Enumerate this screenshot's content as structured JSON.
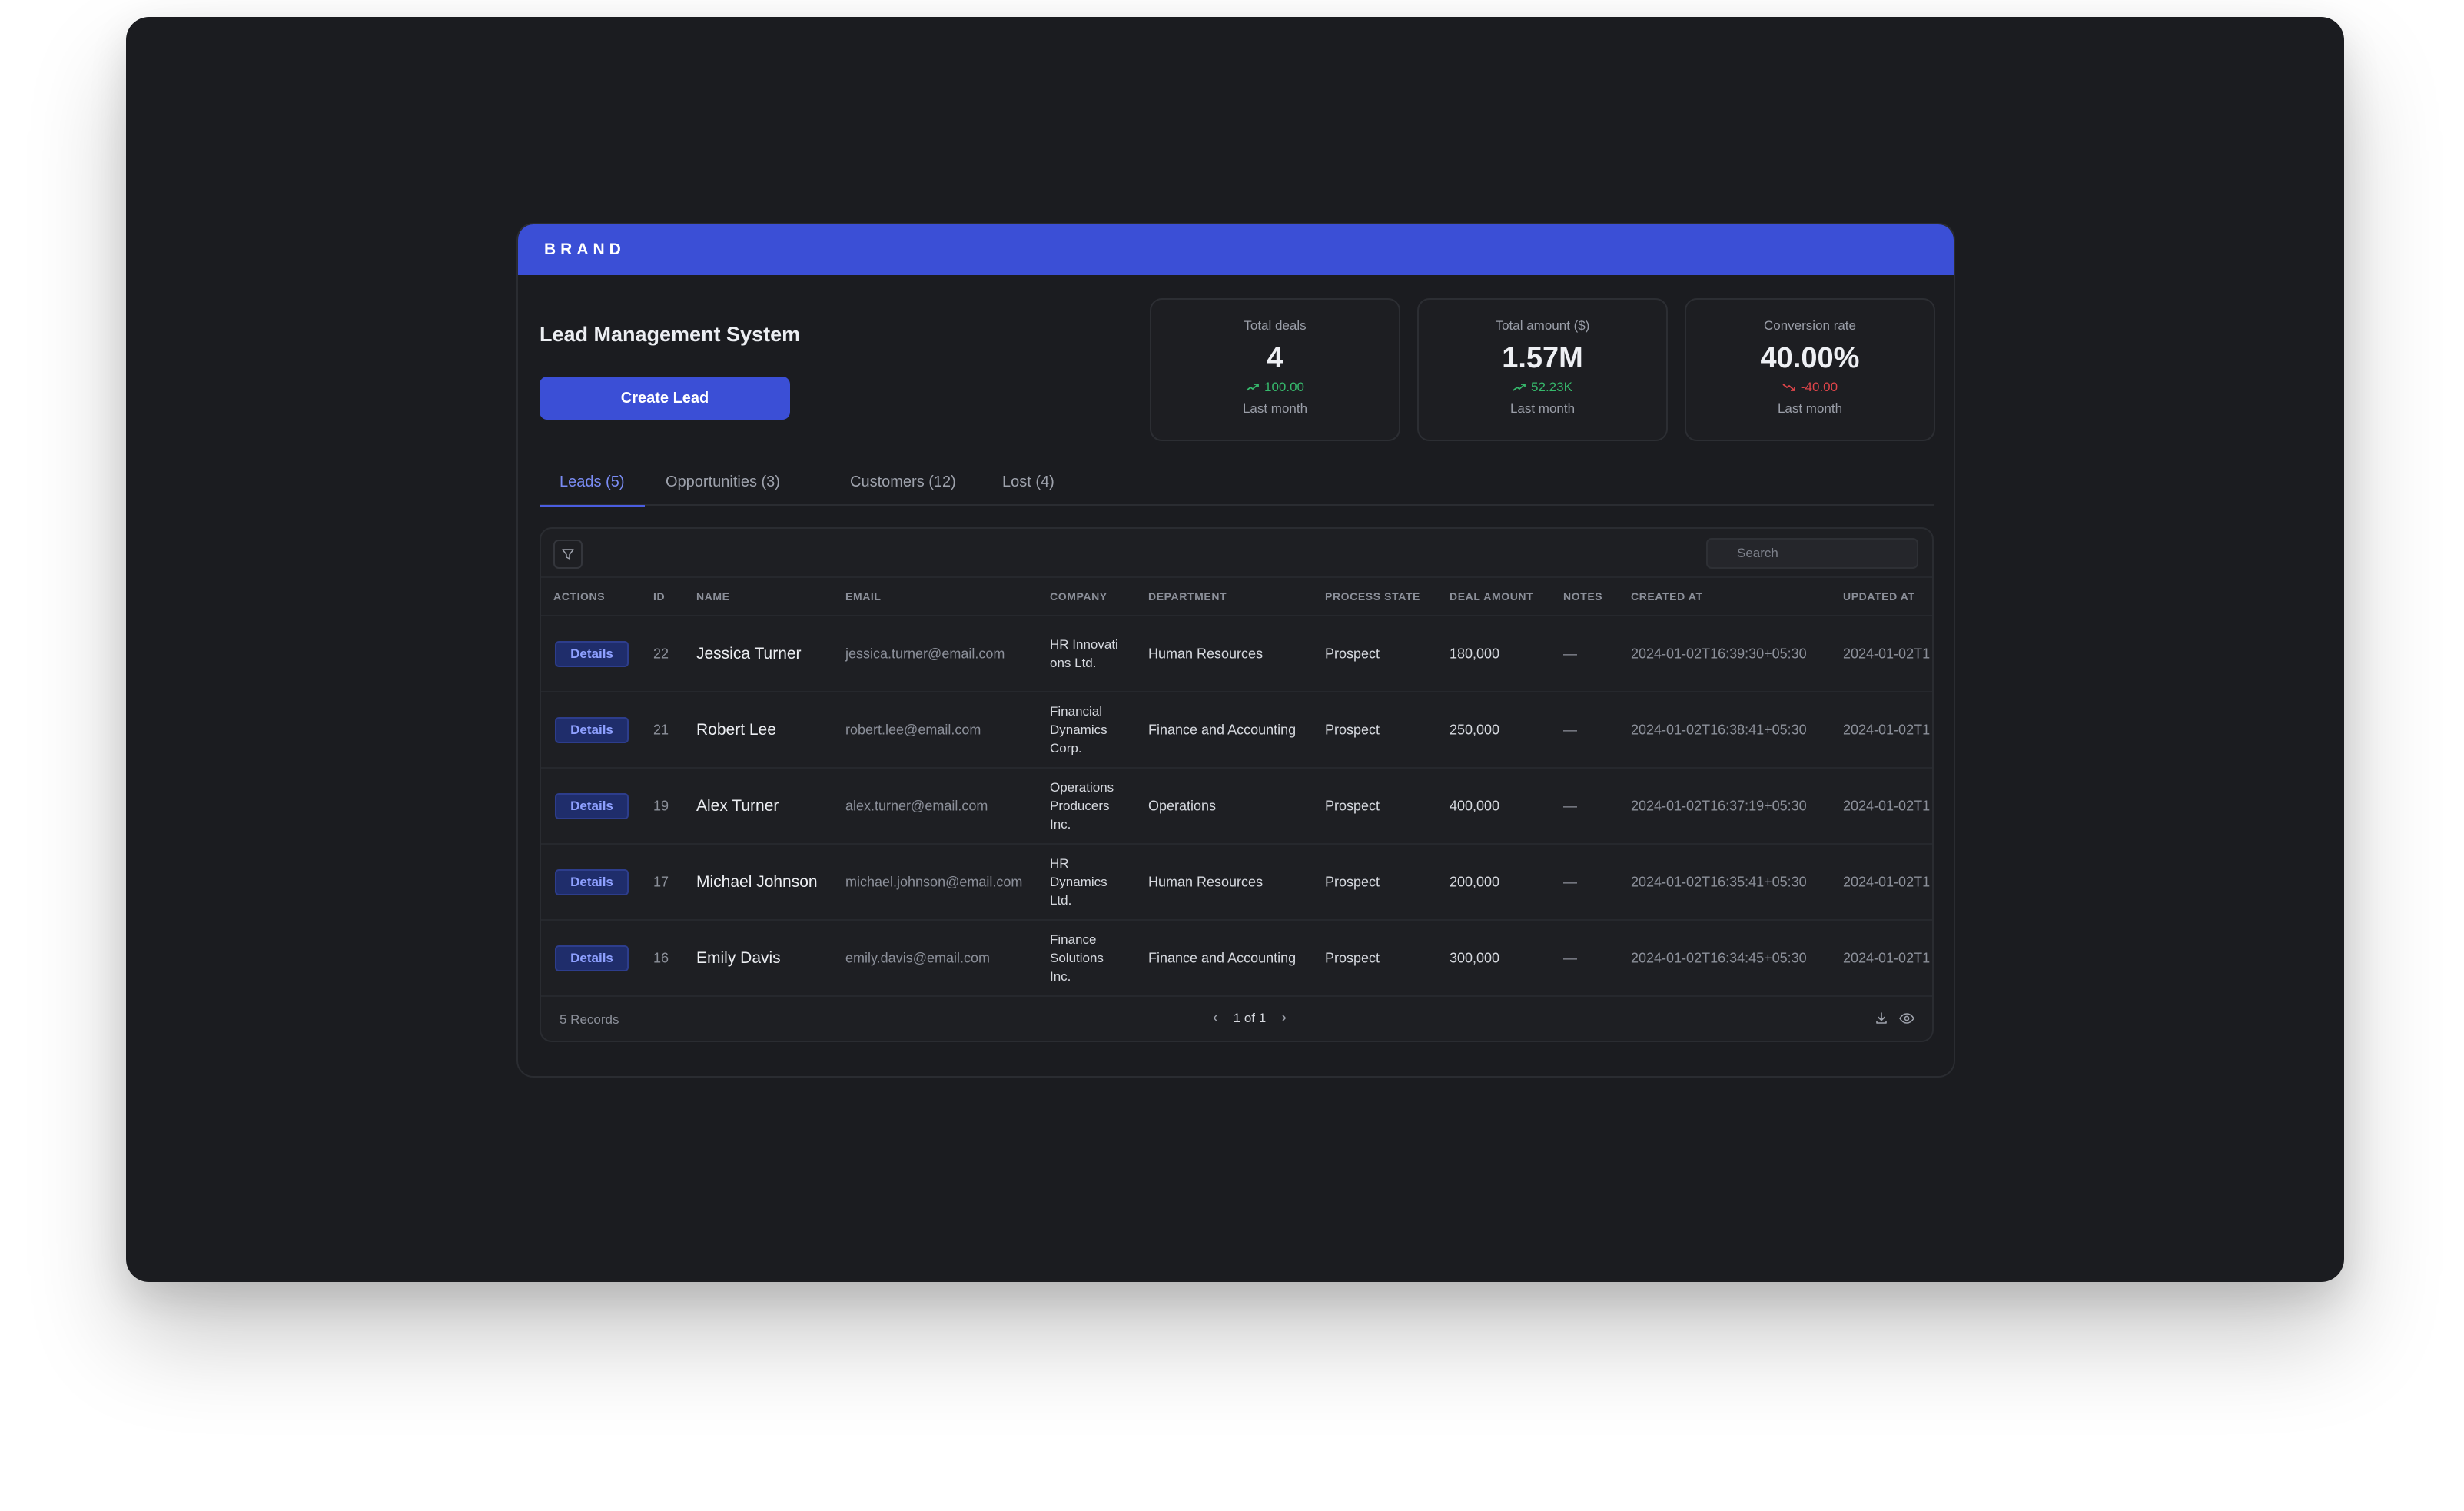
{
  "brand": "BRAND",
  "page_title": "Lead Management System",
  "create_button": "Create Lead",
  "stats": [
    {
      "title": "Total deals",
      "value": "4",
      "delta": "100.00",
      "trend": "up",
      "sub": "Last month"
    },
    {
      "title": "Total amount ($)",
      "value": "1.57M",
      "delta": "52.23K",
      "trend": "up",
      "sub": "Last month"
    },
    {
      "title": "Conversion rate",
      "value": "40.00%",
      "delta": "-40.00",
      "trend": "down",
      "sub": "Last month"
    }
  ],
  "tabs": [
    {
      "label": "Leads (5)",
      "active": true
    },
    {
      "label": "Opportunities (3)",
      "active": false
    },
    {
      "label": "Customers (12)",
      "active": false
    },
    {
      "label": "Lost (4)",
      "active": false
    }
  ],
  "search": {
    "placeholder": "Search"
  },
  "columns": [
    "ACTIONS",
    "ID",
    "NAME",
    "EMAIL",
    "COMPANY",
    "DEPARTMENT",
    "PROCESS STATE",
    "DEAL AMOUNT",
    "NOTES",
    "CREATED AT",
    "UPDATED AT"
  ],
  "rows": [
    {
      "action": "Details",
      "id": "22",
      "name": "Jessica Turner",
      "email": "jessica.turner@email.com",
      "company": "HR Innovati ons Ltd.",
      "department": "Human Resources",
      "state": "Prospect",
      "amount": "180,000",
      "notes": "—",
      "created": "2024-01-02T16:39:30+05:30",
      "updated": "2024-01-02T1"
    },
    {
      "action": "Details",
      "id": "21",
      "name": "Robert Lee",
      "email": "robert.lee@email.com",
      "company": "Financial Dynamics Corp.",
      "department": "Finance and Accounting",
      "state": "Prospect",
      "amount": "250,000",
      "notes": "—",
      "created": "2024-01-02T16:38:41+05:30",
      "updated": "2024-01-02T1"
    },
    {
      "action": "Details",
      "id": "19",
      "name": "Alex Turner",
      "email": "alex.turner@email.com",
      "company": "Operations Producers Inc.",
      "department": "Operations",
      "state": "Prospect",
      "amount": "400,000",
      "notes": "—",
      "created": "2024-01-02T16:37:19+05:30",
      "updated": "2024-01-02T1"
    },
    {
      "action": "Details",
      "id": "17",
      "name": "Michael Johnson",
      "email": "michael.johnson@email.com",
      "company": "HR Dynamics Ltd.",
      "department": "Human Resources",
      "state": "Prospect",
      "amount": "200,000",
      "notes": "—",
      "created": "2024-01-02T16:35:41+05:30",
      "updated": "2024-01-02T1"
    },
    {
      "action": "Details",
      "id": "16",
      "name": "Emily Davis",
      "email": "emily.davis@email.com",
      "company": "Finance Solutions Inc.",
      "department": "Finance and Accounting",
      "state": "Prospect",
      "amount": "300,000",
      "notes": "—",
      "created": "2024-01-02T16:34:45+05:30",
      "updated": "2024-01-02T1"
    }
  ],
  "footer": {
    "records": "5 Records",
    "pagination": "1 of 1"
  },
  "colors": {
    "accent": "#3b4fd6",
    "positive": "#36b96c",
    "negative": "#e0454a",
    "background": "#1b1c20"
  }
}
